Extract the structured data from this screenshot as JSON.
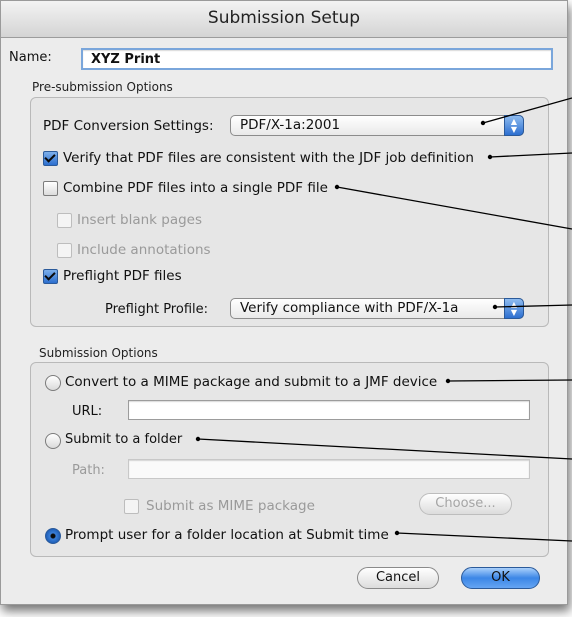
{
  "window": {
    "title": "Submission Setup"
  },
  "name_field": {
    "label": "Name:",
    "value": "XYZ Print"
  },
  "pre_submission": {
    "title": "Pre-submission Options",
    "pdf_conversion": {
      "label": "PDF Conversion Settings:",
      "value": "PDF/X-1a:2001"
    },
    "verify": {
      "label": "Verify that PDF files are consistent with the JDF job definition",
      "checked": true
    },
    "combine": {
      "label": "Combine PDF files into a single PDF file",
      "checked": false
    },
    "insert_blank": {
      "label": "Insert blank pages",
      "checked": false,
      "enabled": false
    },
    "include_annotations": {
      "label": "Include annotations",
      "checked": false,
      "enabled": false
    },
    "preflight": {
      "label": "Preflight PDF files",
      "checked": true
    },
    "preflight_profile": {
      "label": "Preflight Profile:",
      "value": "Verify compliance with PDF/X-1a"
    }
  },
  "submission": {
    "title": "Submission Options",
    "mime": {
      "label": "Convert to a MIME package and submit to a JMF device",
      "selected": false
    },
    "url": {
      "label": "URL:",
      "value": ""
    },
    "folder": {
      "label": "Submit to a folder",
      "selected": false
    },
    "path": {
      "label": "Path:",
      "value": ""
    },
    "submit_as_mime": {
      "label": "Submit as MIME package",
      "checked": false,
      "enabled": false
    },
    "choose_button": "Choose...",
    "prompt": {
      "label": "Prompt user for a folder location at Submit time",
      "selected": true
    }
  },
  "buttons": {
    "cancel": "Cancel",
    "ok": "OK"
  },
  "colors": {
    "accent": "#3b86e6",
    "window_bg": "#ececec"
  }
}
